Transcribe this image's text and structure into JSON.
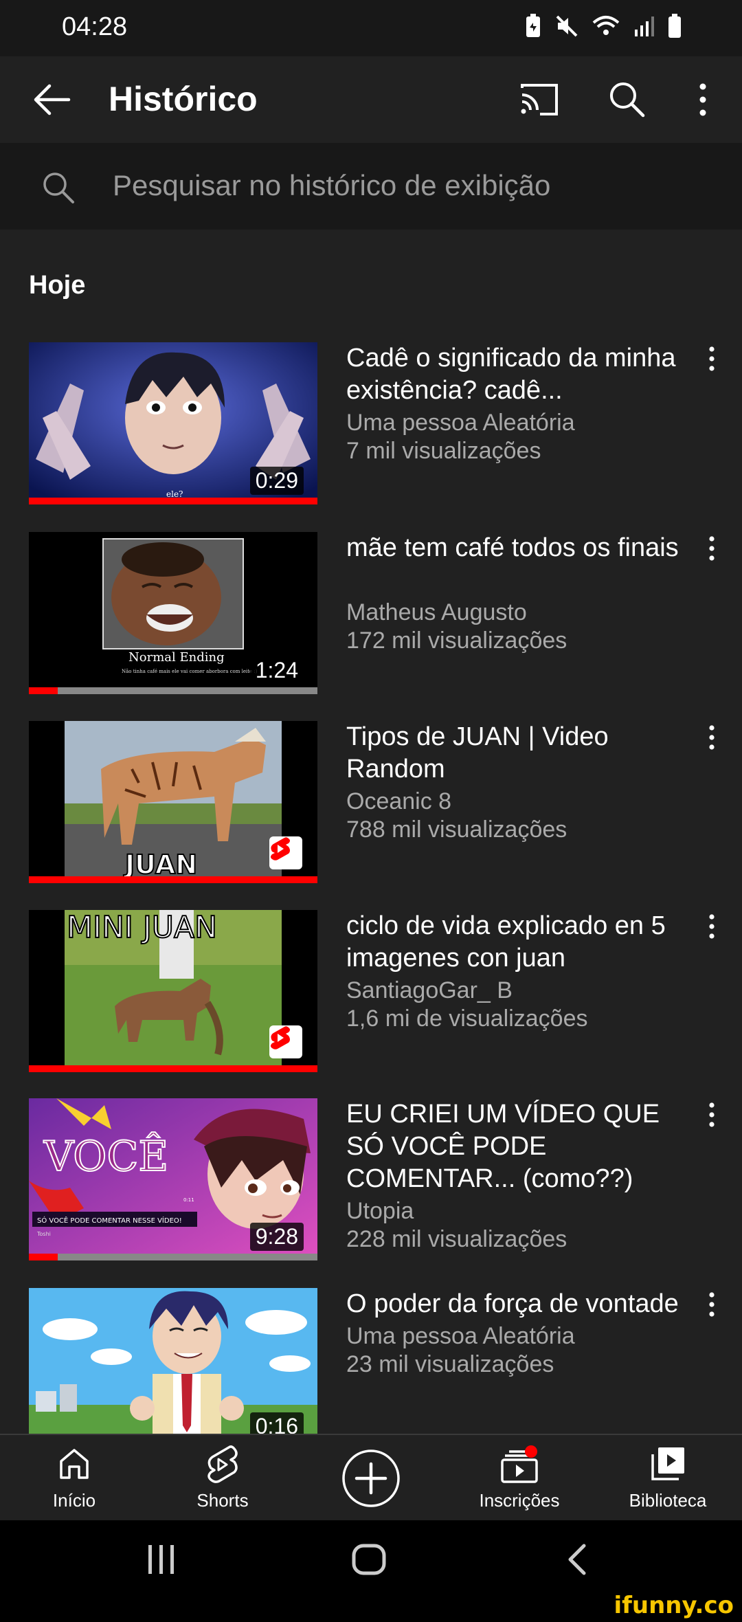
{
  "status_bar": {
    "time": "04:28",
    "icons": [
      "battery-saver-icon",
      "mute-icon",
      "wifi-icon",
      "signal-icon",
      "battery-icon"
    ]
  },
  "app_bar": {
    "title": "Histórico",
    "icons": [
      "back-arrow-icon",
      "cast-icon",
      "search-icon",
      "more-vertical-icon"
    ]
  },
  "search": {
    "placeholder": "Pesquisar no histórico de exibição"
  },
  "section": {
    "title": "Hoje"
  },
  "videos": [
    {
      "title": "Cadê o significado da minha existência? cadê...",
      "channel": "Uma pessoa Aleatória",
      "views": "7 mil visualizações",
      "duration": "0:29",
      "progress": 1.0,
      "thumb_caption": "ele?"
    },
    {
      "title": "mãe tem café todos os finais",
      "channel": "Matheus Augusto",
      "views": "172 mil visualizações",
      "duration": "1:24",
      "progress": 0.1,
      "thumb_caption": "Normal Ending",
      "thumb_subcaption": "Não tinha café mais ele vai comer aborbora com leite :)"
    },
    {
      "title": "Tipos de JUAN | Video Random",
      "channel": "Oceanic 8",
      "views": "788 mil visualizações",
      "progress": 1.0,
      "thumb_caption": "JUAN",
      "shorts": true
    },
    {
      "title": "ciclo de vida explicado en 5 imagenes con juan",
      "channel": "SantiagoGar_ B",
      "views": "1,6 mi de visualizações",
      "progress": 1.0,
      "thumb_caption": "MINI JUAN",
      "shorts": true
    },
    {
      "title": "EU CRIEI UM VÍDEO QUE SÓ VOCÊ PODE COMENTAR... (como??)",
      "channel": "Utopia",
      "views": "228 mil visualizações",
      "duration": "9:28",
      "progress": 0.1,
      "thumb_caption": "VOCÊ",
      "thumb_subcaption": "SÓ VOCÊ PODE COMENTAR NESSE VÍDEO!",
      "thumb_name": "Toshi",
      "thumb_time": "0:11"
    },
    {
      "title": "O poder da força de vontade",
      "channel": "Uma pessoa Aleatória",
      "views": "23 mil visualizações",
      "duration": "0:16"
    }
  ],
  "bottom_nav": {
    "items": [
      {
        "label": "Início",
        "icon": "home-icon"
      },
      {
        "label": "Shorts",
        "icon": "shorts-icon"
      },
      {
        "label": "",
        "icon": "create-icon"
      },
      {
        "label": "Inscrições",
        "icon": "subscriptions-icon"
      },
      {
        "label": "Biblioteca",
        "icon": "library-icon"
      }
    ]
  },
  "android_nav": {
    "icons": [
      "recents-icon",
      "home-button-icon",
      "back-button-icon"
    ]
  },
  "watermark": "ifunny.co",
  "colors": {
    "background": "#212121",
    "accent_red": "#ff0000",
    "text_secondary": "#aaaaaa",
    "watermark": "#f7c600"
  }
}
